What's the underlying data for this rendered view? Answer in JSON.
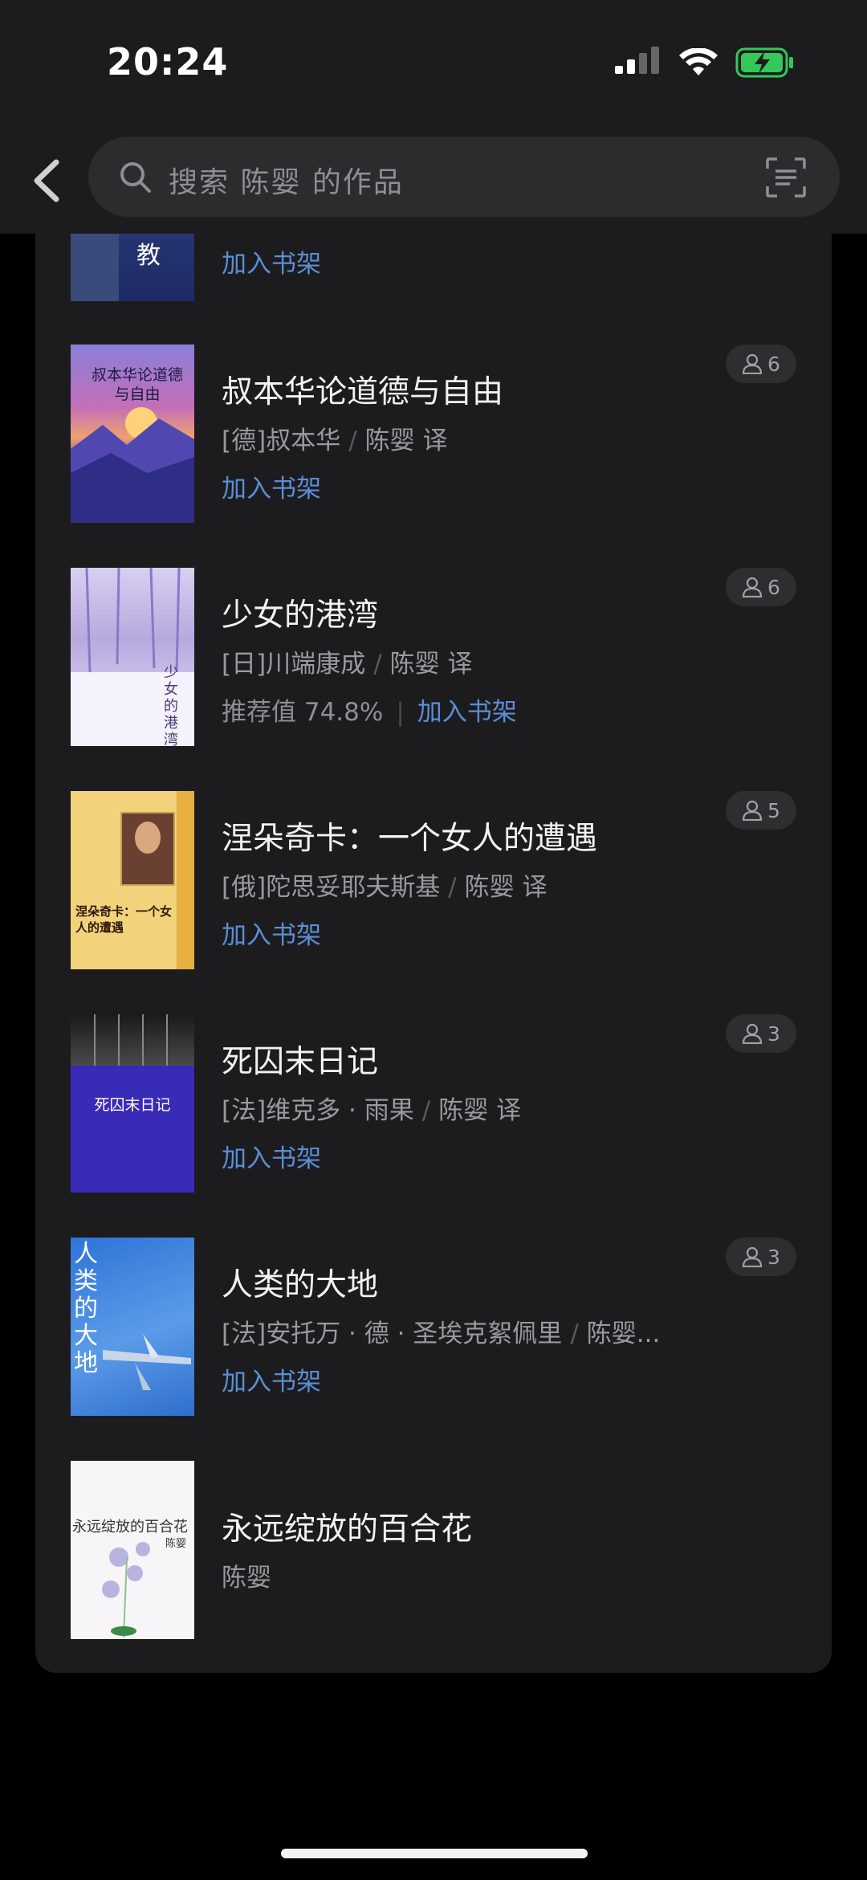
{
  "status": {
    "time": "20:24"
  },
  "search": {
    "placeholder": "搜索 陈婴 的作品"
  },
  "top_partial": {
    "cover_char": "教",
    "action": "加入书架"
  },
  "books": [
    {
      "title": "叔本华论道德与自由",
      "author": "[德]叔本华",
      "translator": "陈婴",
      "trans_suffix": "译",
      "action": "加入书架",
      "readers": "6",
      "cover_text": "叔本华论道德与自由"
    },
    {
      "title": "少女的港湾",
      "author": "[日]川端康成",
      "translator": "陈婴",
      "trans_suffix": "译",
      "rating": "推荐值 74.8%",
      "action": "加入书架",
      "readers": "6",
      "cover_text": "少女的港湾"
    },
    {
      "title": "涅朵奇卡：一个女人的遭遇",
      "author": "[俄]陀思妥耶夫斯基",
      "translator": "陈婴",
      "trans_suffix": "译",
      "action": "加入书架",
      "readers": "5",
      "cover_text": "涅朵奇卡：一个女人的遭遇"
    },
    {
      "title": "死囚末日记",
      "author": "[法]维克多 · 雨果",
      "translator": "陈婴",
      "trans_suffix": "译",
      "action": "加入书架",
      "readers": "3",
      "cover_text": "死囚末日记"
    },
    {
      "title": "人类的大地",
      "author": "[法]安托万 · 德 · 圣埃克絮佩里",
      "translator": "陈婴...",
      "action": "加入书架",
      "readers": "3",
      "cover_text": "人类的大地"
    },
    {
      "title": "永远绽放的百合花",
      "author": "陈婴",
      "cover_text": "永远绽放的百合花",
      "cover_author": "陈婴"
    }
  ],
  "colors": {
    "background": "#000000",
    "card": "#1c1c1e",
    "link": "#5b8ed6",
    "battery": "#34c759"
  }
}
